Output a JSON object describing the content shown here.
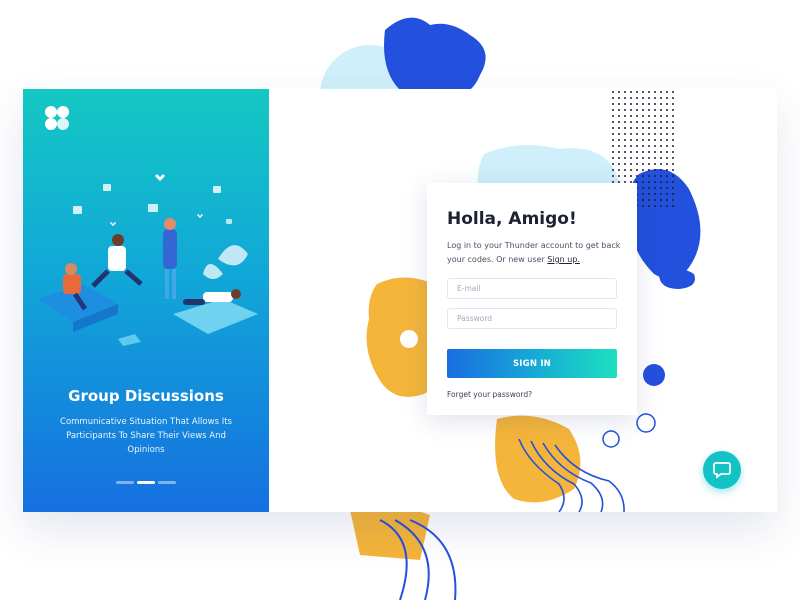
{
  "brand": {
    "logo_icon": "clover-logo-icon",
    "accent": "#14c8c2"
  },
  "onboarding": {
    "title": "Group Discussions",
    "subtitle": "Communicative Situation That Allows Its Participants To Share Their Views And Opinions",
    "slide_count": 3,
    "active_slide": 2
  },
  "login": {
    "title": "Holla, Amigo!",
    "description": "Log in to your Thunder account to get back your codes. Or new user",
    "signup_link": "Sign up.",
    "email_placeholder": "E-mail",
    "password_placeholder": "Password",
    "signin_label": "SIGN IN",
    "forgot_label": "Forget your password?",
    "button_gradient": [
      "#1a6de0",
      "#1de0c0"
    ]
  },
  "chat": {
    "icon": "chat-bubble-icon",
    "color": "#12c2c4"
  }
}
